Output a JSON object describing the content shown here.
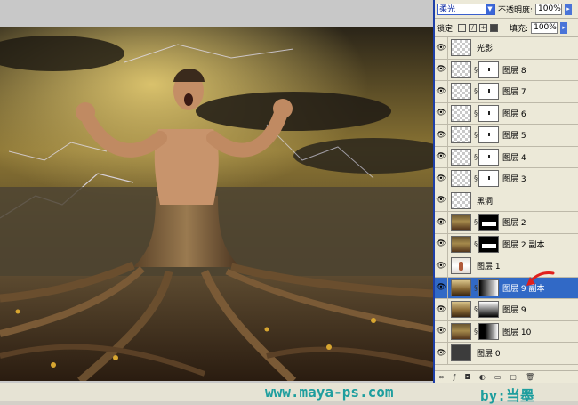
{
  "panel": {
    "blend_mode": "柔光",
    "opacity_label": "不透明度:",
    "opacity_value": "100%",
    "lock_label": "锁定:",
    "fill_label": "填充:",
    "fill_value": "100%"
  },
  "layers": [
    {
      "name": "光影",
      "thumb": "checker",
      "mask": "none"
    },
    {
      "name": "图层 8",
      "thumb": "checker",
      "mask": "dot"
    },
    {
      "name": "图层 7",
      "thumb": "checker",
      "mask": "dot"
    },
    {
      "name": "图层 6",
      "thumb": "checker",
      "mask": "dot"
    },
    {
      "name": "图层 5",
      "thumb": "checker",
      "mask": "dot"
    },
    {
      "name": "图层 4",
      "thumb": "checker",
      "mask": "dot"
    },
    {
      "name": "图层 3",
      "thumb": "checker",
      "mask": "dot"
    },
    {
      "name": "黑洞",
      "thumb": "checker",
      "mask": "none"
    },
    {
      "name": "图层 2",
      "thumb": "photo",
      "mask": "black"
    },
    {
      "name": "图层 2 副本",
      "thumb": "photo",
      "mask": "black"
    },
    {
      "name": "图层 1",
      "thumb": "person",
      "mask": "none"
    },
    {
      "name": "图层 9 副本",
      "thumb": "photo2",
      "mask": "grad",
      "selected": true
    },
    {
      "name": "图层 9",
      "thumb": "photo2",
      "mask": "grad2"
    },
    {
      "name": "图层 10",
      "thumb": "photo",
      "mask": "grad3"
    },
    {
      "name": "图层 0",
      "thumb": "dark",
      "mask": "none"
    }
  ],
  "footer": {
    "site": "www.maya-ps.com",
    "author": "by:当墨"
  },
  "colors": {
    "selection": "#3169c6",
    "panel_bg": "#ece9d8",
    "footer_text": "#1e9e9e",
    "arrow": "#e0201c"
  }
}
